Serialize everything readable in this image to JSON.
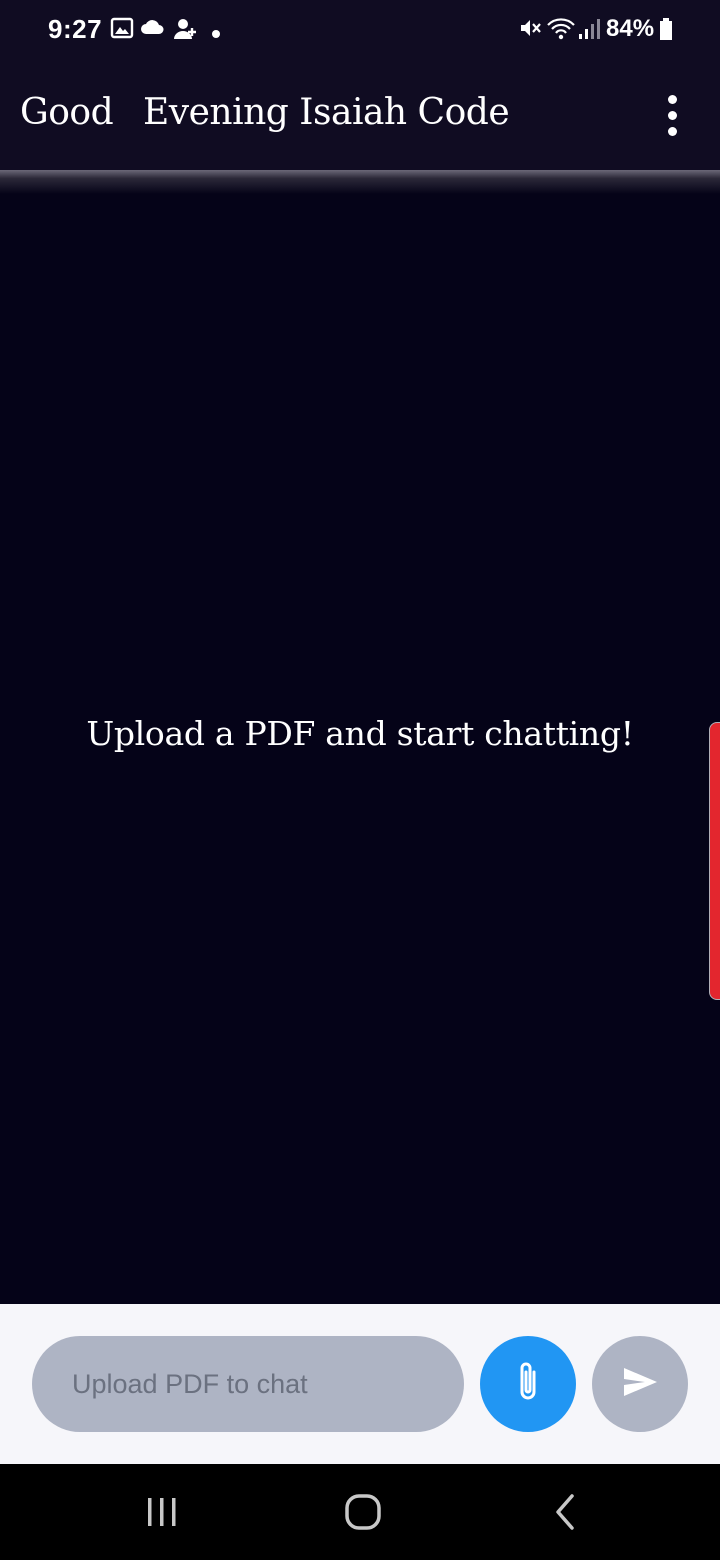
{
  "status_bar": {
    "time": "9:27",
    "battery": "84%",
    "left_icons": [
      "image-icon",
      "cloud-icon",
      "person-add-icon",
      "notification-dot-icon"
    ],
    "right_icons": [
      "mute-icon",
      "wifi-icon",
      "signal-icon",
      "battery-icon"
    ]
  },
  "app_bar": {
    "greeting_part1": "Good",
    "greeting_part2": "Evening Isaiah Code",
    "menu_icon": "more-vert-icon"
  },
  "chat": {
    "empty_message": "Upload a PDF and start chatting!"
  },
  "input_bar": {
    "placeholder": "Upload PDF to chat",
    "attach_icon": "paperclip-icon",
    "send_icon": "send-icon"
  },
  "nav_bar": {
    "buttons": [
      "recents-icon",
      "home-icon",
      "back-icon"
    ]
  },
  "colors": {
    "background": "#050318",
    "app_bar": "#100c22",
    "attach_accent": "#2196f3",
    "disabled": "#aeb4c4",
    "edge_handle": "#e3262e"
  }
}
